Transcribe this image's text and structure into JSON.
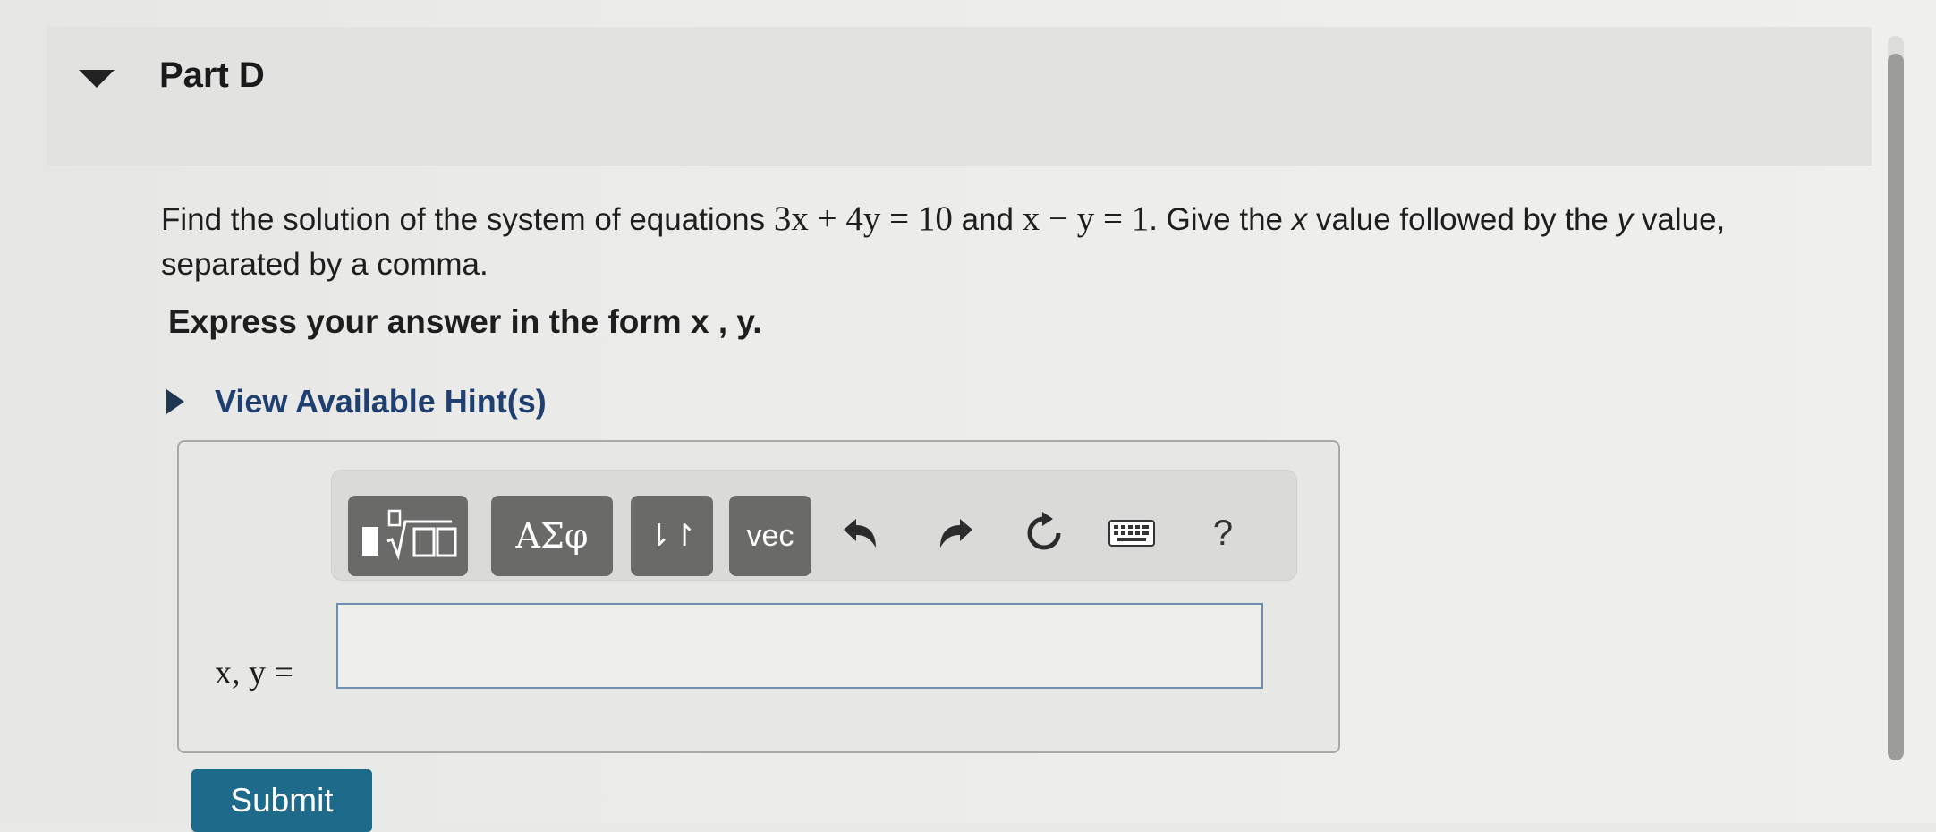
{
  "part": {
    "title": "Part D",
    "caret_icon": "caret-down-icon"
  },
  "question": {
    "text_1": "Find the solution of the system of equations",
    "eq1": "3x + 4y = 10",
    "and": "and",
    "eq2": "x − y = 1",
    "text_2": ". Give the",
    "var_x": "x",
    "text_3": "value followed by the",
    "var_y": "y",
    "text_4": "value,",
    "text_5": "separated by a comma."
  },
  "instruction": "Express your answer in the form x , y.",
  "hint": {
    "label": "View Available Hint(s)",
    "icon": "caret-right-icon"
  },
  "toolbar": {
    "templates_icon": "templates-icon",
    "greek_label": "ΑΣφ",
    "arrows_label": "⇂↾",
    "vec_label": "vec",
    "undo_icon": "undo-icon",
    "redo_icon": "redo-icon",
    "reset_icon": "reset-icon",
    "keyboard_icon": "keyboard-icon",
    "help_label": "?"
  },
  "answer": {
    "label": "x, y =",
    "value": "",
    "placeholder": ""
  },
  "submit_label": "Submit",
  "colors": {
    "hint_link": "#1f3f70",
    "toolbar_button": "#6a6a68",
    "submit_button": "#1e6a8a",
    "input_border": "#6e8fb0"
  }
}
